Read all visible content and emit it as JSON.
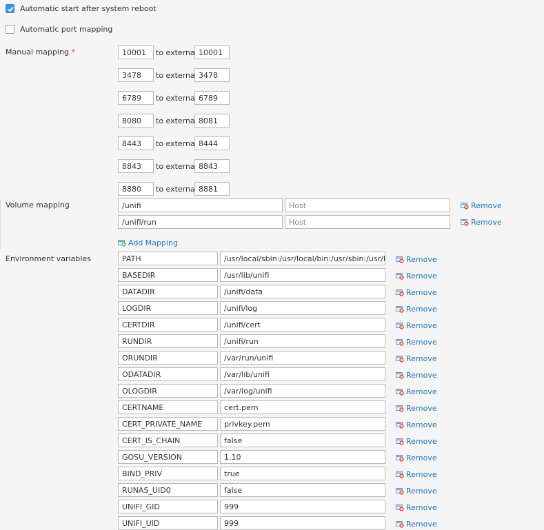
{
  "options": {
    "auto_start": {
      "label": "Automatic start after system reboot",
      "checked": true
    },
    "auto_port": {
      "label": "Automatic port mapping",
      "checked": false
    }
  },
  "manual_mapping": {
    "label": "Manual mapping",
    "required_mark": "*",
    "to_label": "to external",
    "rows": [
      {
        "internal": "10001",
        "external": "10001"
      },
      {
        "internal": "3478",
        "external": "3478"
      },
      {
        "internal": "6789",
        "external": "6789"
      },
      {
        "internal": "8080",
        "external": "8081"
      },
      {
        "internal": "8443",
        "external": "8444"
      },
      {
        "internal": "8843",
        "external": "8843"
      },
      {
        "internal": "8880",
        "external": "8881"
      }
    ]
  },
  "volume_mapping": {
    "label": "Volume mapping",
    "host_placeholder": "Host",
    "remove_label": "Remove",
    "rows": [
      {
        "container": "/unifi",
        "host": ""
      },
      {
        "container": "/unifi/run",
        "host": ""
      }
    ],
    "add_label": "Add Mapping"
  },
  "environment": {
    "label": "Environment variables",
    "remove_label": "Remove",
    "rows": [
      {
        "name": "PATH",
        "value": "/usr/local/sbin:/usr/local/bin:/usr/sbin:/usr/bin"
      },
      {
        "name": "BASEDIR",
        "value": "/usr/lib/unifi"
      },
      {
        "name": "DATADIR",
        "value": "/unifi/data"
      },
      {
        "name": "LOGDIR",
        "value": "/unifi/log"
      },
      {
        "name": "CERTDIR",
        "value": "/unifi/cert"
      },
      {
        "name": "RUNDIR",
        "value": "/unifi/run"
      },
      {
        "name": "ORUNDIR",
        "value": "/var/run/unifi"
      },
      {
        "name": "ODATADIR",
        "value": "/var/lib/unifi"
      },
      {
        "name": "OLOGDIR",
        "value": "/var/log/unifi"
      },
      {
        "name": "CERTNAME",
        "value": "cert.pem"
      },
      {
        "name": "CERT_PRIVATE_NAME",
        "value": "privkey.pem"
      },
      {
        "name": "CERT_IS_CHAIN",
        "value": "false"
      },
      {
        "name": "GOSU_VERSION",
        "value": "1.10"
      },
      {
        "name": "BIND_PRIV",
        "value": "true"
      },
      {
        "name": "RUNAS_UID0",
        "value": "false"
      },
      {
        "name": "UNIFI_GID",
        "value": "999"
      },
      {
        "name": "UNIFI_UID",
        "value": "999"
      }
    ]
  },
  "colors": {
    "link": "#2377b7",
    "accent": "#3b98d6",
    "required": "#e03c3c",
    "remove_icon": "#d9534f",
    "add_icon": "#5cb85c"
  }
}
